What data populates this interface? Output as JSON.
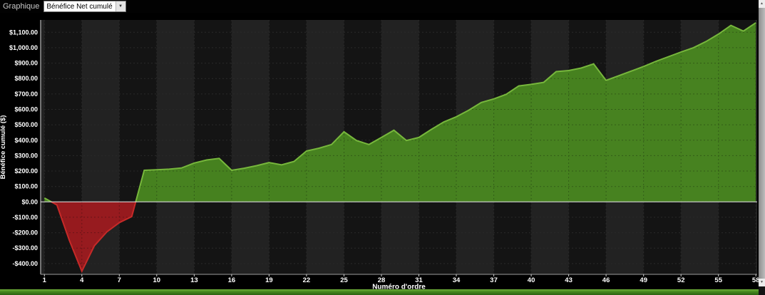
{
  "toolbar": {
    "label": "Graphique",
    "dropdown_value": "Bénéfice Net cumulé"
  },
  "icons": {
    "dropdown_arrow": "▼",
    "scroll_up_arrow": "▲",
    "scroll_down_arrow": "▼"
  },
  "chart_data": {
    "type": "area",
    "xlabel": "Numéro d'ordre",
    "ylabel": "Bénéfice cumulé ($)",
    "x_start": 1,
    "values": [
      25,
      -20,
      -250,
      -450,
      -285,
      -195,
      -135,
      -95,
      205,
      208,
      212,
      220,
      252,
      272,
      282,
      205,
      218,
      235,
      255,
      240,
      262,
      330,
      348,
      372,
      455,
      398,
      372,
      418,
      465,
      398,
      418,
      470,
      518,
      552,
      595,
      645,
      668,
      698,
      752,
      762,
      775,
      845,
      852,
      868,
      895,
      788,
      818,
      848,
      878,
      912,
      942,
      972,
      1000,
      1040,
      1088,
      1145,
      1108,
      1162
    ],
    "x_ticks": [
      1,
      4,
      7,
      10,
      13,
      16,
      19,
      22,
      25,
      28,
      31,
      34,
      37,
      40,
      43,
      46,
      49,
      52,
      55,
      58
    ],
    "y_ticks": [
      {
        "value": 1100,
        "label": "$1,100.00"
      },
      {
        "value": 1000,
        "label": "$1,000.00"
      },
      {
        "value": 900,
        "label": "$900.00"
      },
      {
        "value": 800,
        "label": "$800.00"
      },
      {
        "value": 700,
        "label": "$700.00"
      },
      {
        "value": 600,
        "label": "$600.00"
      },
      {
        "value": 500,
        "label": "$500.00"
      },
      {
        "value": 400,
        "label": "$400.00"
      },
      {
        "value": 300,
        "label": "$300.00"
      },
      {
        "value": 200,
        "label": "$200.00"
      },
      {
        "value": 100,
        "label": "$100.00"
      },
      {
        "value": 0,
        "label": "$0.00"
      },
      {
        "value": -100,
        "label": "-$100.00"
      },
      {
        "value": -200,
        "label": "-$200.00"
      },
      {
        "value": -300,
        "label": "-$300.00"
      },
      {
        "value": -400,
        "label": "-$400.00"
      }
    ],
    "xlim": [
      0.7,
      58.1
    ],
    "ylim": [
      -470,
      1180
    ],
    "baseline": 0,
    "grid": true,
    "legend": false,
    "colors": {
      "background": "#141414",
      "band": "#222222",
      "grid": "#3a3a3a",
      "zero_line": "#e8e8e8",
      "positive_fill": "#4a8a20",
      "positive_line": "#77b73c",
      "negative_fill": "#a01b1f",
      "negative_line": "#c62a28",
      "text": "#ffffff"
    }
  }
}
